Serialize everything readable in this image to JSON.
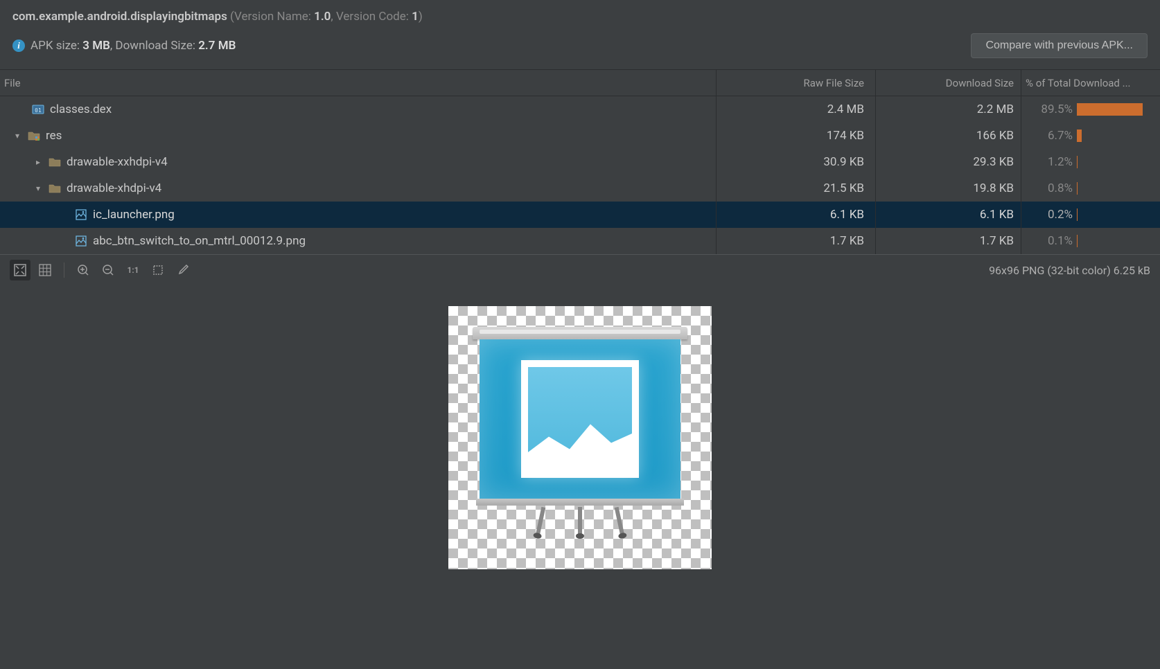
{
  "header": {
    "package": "com.example.android.displayingbitmaps",
    "version_name_label": "Version Name:",
    "version_name": "1.0",
    "version_code_label": "Version Code:",
    "version_code": "1",
    "open_paren": " (",
    "comma_sep": ", ",
    "close_paren": ")",
    "apk_size_label": "APK size: ",
    "apk_size": "3 MB",
    "download_size_label": ", Download Size: ",
    "download_size": "2.7 MB",
    "compare_button": "Compare with previous APK..."
  },
  "columns": {
    "file": "File",
    "raw": "Raw File Size",
    "dl": "Download Size",
    "pct": "% of Total Download ..."
  },
  "rows": [
    {
      "name": "classes.dex",
      "raw": "2.4 MB",
      "dl": "2.2 MB",
      "pct": "89.5%",
      "bar": 89.5,
      "indent": 0,
      "chevron": "",
      "icon": "dex",
      "selected": false
    },
    {
      "name": "res",
      "raw": "174 KB",
      "dl": "166 KB",
      "pct": "6.7%",
      "bar": 6.7,
      "indent": 1,
      "chevron": "down",
      "icon": "folder-res",
      "selected": false
    },
    {
      "name": "drawable-xxhdpi-v4",
      "raw": "30.9 KB",
      "dl": "29.3 KB",
      "pct": "1.2%",
      "bar": 1.2,
      "indent": 2,
      "chevron": "right",
      "icon": "folder",
      "selected": false
    },
    {
      "name": "drawable-xhdpi-v4",
      "raw": "21.5 KB",
      "dl": "19.8 KB",
      "pct": "0.8%",
      "bar": 0.8,
      "indent": 2,
      "chevron": "down",
      "icon": "folder",
      "selected": false
    },
    {
      "name": "ic_launcher.png",
      "raw": "6.1 KB",
      "dl": "6.1 KB",
      "pct": "0.2%",
      "bar": 0.2,
      "indent": 3,
      "chevron": "",
      "icon": "image",
      "selected": true
    },
    {
      "name": "abc_btn_switch_to_on_mtrl_00012.9.png",
      "raw": "1.7 KB",
      "dl": "1.7 KB",
      "pct": "0.1%",
      "bar": 0.1,
      "indent": 3,
      "chevron": "",
      "icon": "image",
      "selected": false
    }
  ],
  "preview": {
    "info": "96x96 PNG (32-bit color) 6.25 kB"
  },
  "toolbar": {
    "t11": "1:1"
  }
}
